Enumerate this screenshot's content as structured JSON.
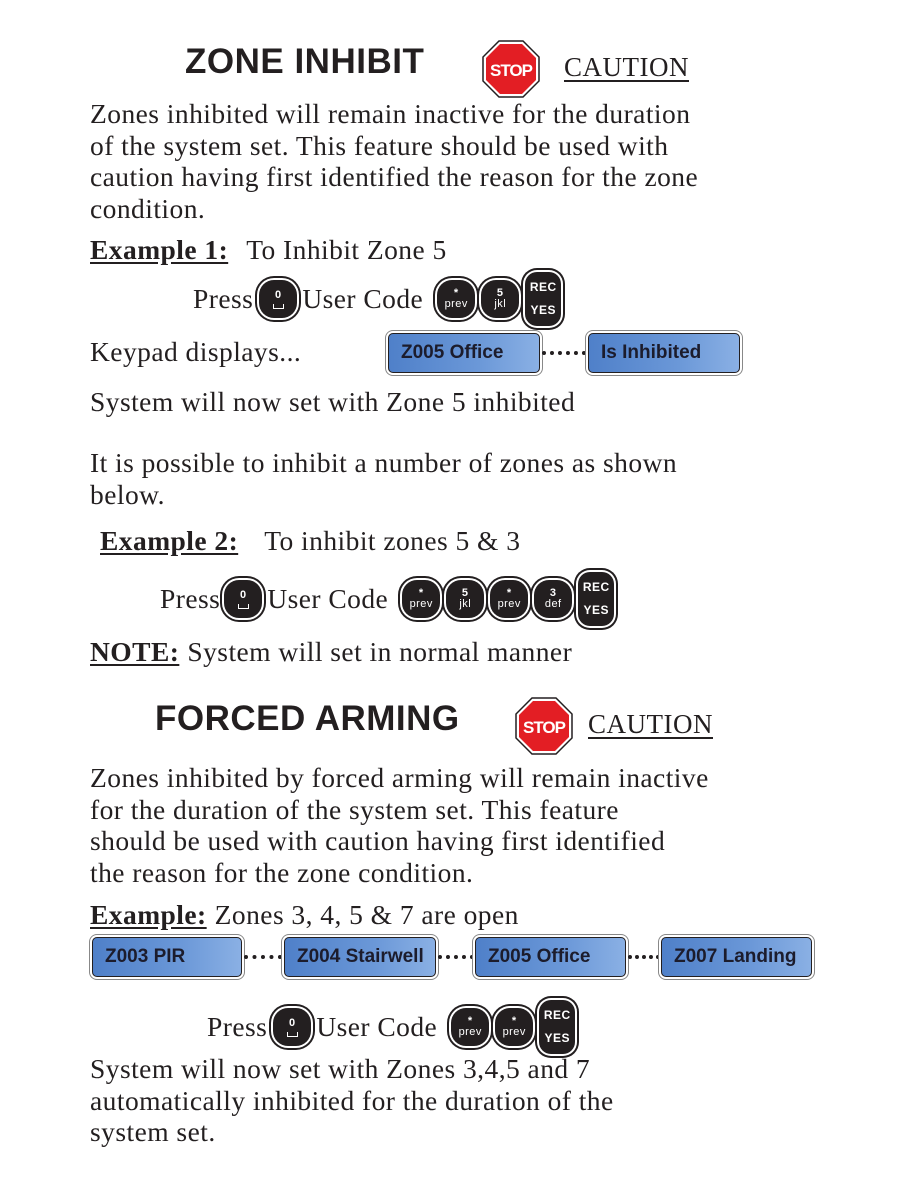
{
  "zone_inhibit": {
    "heading": "ZONE INHIBIT",
    "stop_icon_label": "STOP",
    "caution": "CAUTION",
    "intro": [
      "Zones inhibited will remain inactive for the duration",
      "of the system set. This feature should be used with",
      "caution having first identified the reason for the zone",
      "condition."
    ],
    "example1": {
      "label": "Example 1:",
      "text": "To Inhibit Zone 5",
      "press": "Press",
      "user_code": "User Code",
      "keys": [
        {
          "top": "*",
          "bottom": "prev"
        },
        {
          "top": "5",
          "bottom": "jkl"
        }
      ],
      "enter_key": {
        "top": "REC",
        "bottom": "YES"
      },
      "zero_key": "0",
      "keypad_label": "Keypad displays...",
      "displays": [
        "Z005 Office",
        "Is Inhibited"
      ],
      "result": "System will now set with Zone 5 inhibited"
    },
    "multi_note": [
      "It is possible to inhibit a number of zones as shown",
      "below."
    ],
    "example2": {
      "label": "Example 2:",
      "text": "To inhibit zones 5 & 3",
      "press": "Press",
      "user_code": "User Code",
      "keys": [
        {
          "top": "*",
          "bottom": "prev"
        },
        {
          "top": "5",
          "bottom": "jkl"
        },
        {
          "top": "*",
          "bottom": "prev"
        },
        {
          "top": "3",
          "bottom": "def"
        }
      ],
      "enter_key": {
        "top": "REC",
        "bottom": "YES"
      },
      "zero_key": "0"
    },
    "note": {
      "label": "NOTE:",
      "text": "System will set in normal manner"
    }
  },
  "forced_arming": {
    "heading": "FORCED ARMING",
    "stop_icon_label": "STOP",
    "caution": "CAUTION",
    "intro": [
      "Zones inhibited by forced arming will remain inactive",
      "for the duration of the system set. This feature",
      "should be used with caution having first identified",
      "the reason for the zone condition."
    ],
    "example": {
      "label": "Example:",
      "text": "Zones 3, 4, 5 & 7 are open",
      "displays": [
        "Z003 PIR",
        "Z004 Stairwell",
        "Z005 Office",
        "Z007 Landing"
      ],
      "press": "Press",
      "user_code": "User Code",
      "keys": [
        {
          "top": "*",
          "bottom": "prev"
        },
        {
          "top": "*",
          "bottom": "prev"
        }
      ],
      "enter_key": {
        "top": "REC",
        "bottom": "YES"
      },
      "zero_key": "0"
    },
    "result": [
      "System will now set with Zones 3,4,5 and 7",
      "automatically inhibited for the duration of the",
      "system set."
    ]
  },
  "colors": {
    "stop_red": "#e31e24",
    "lcd_blue": "#6b98d8",
    "text": "#231f20"
  }
}
